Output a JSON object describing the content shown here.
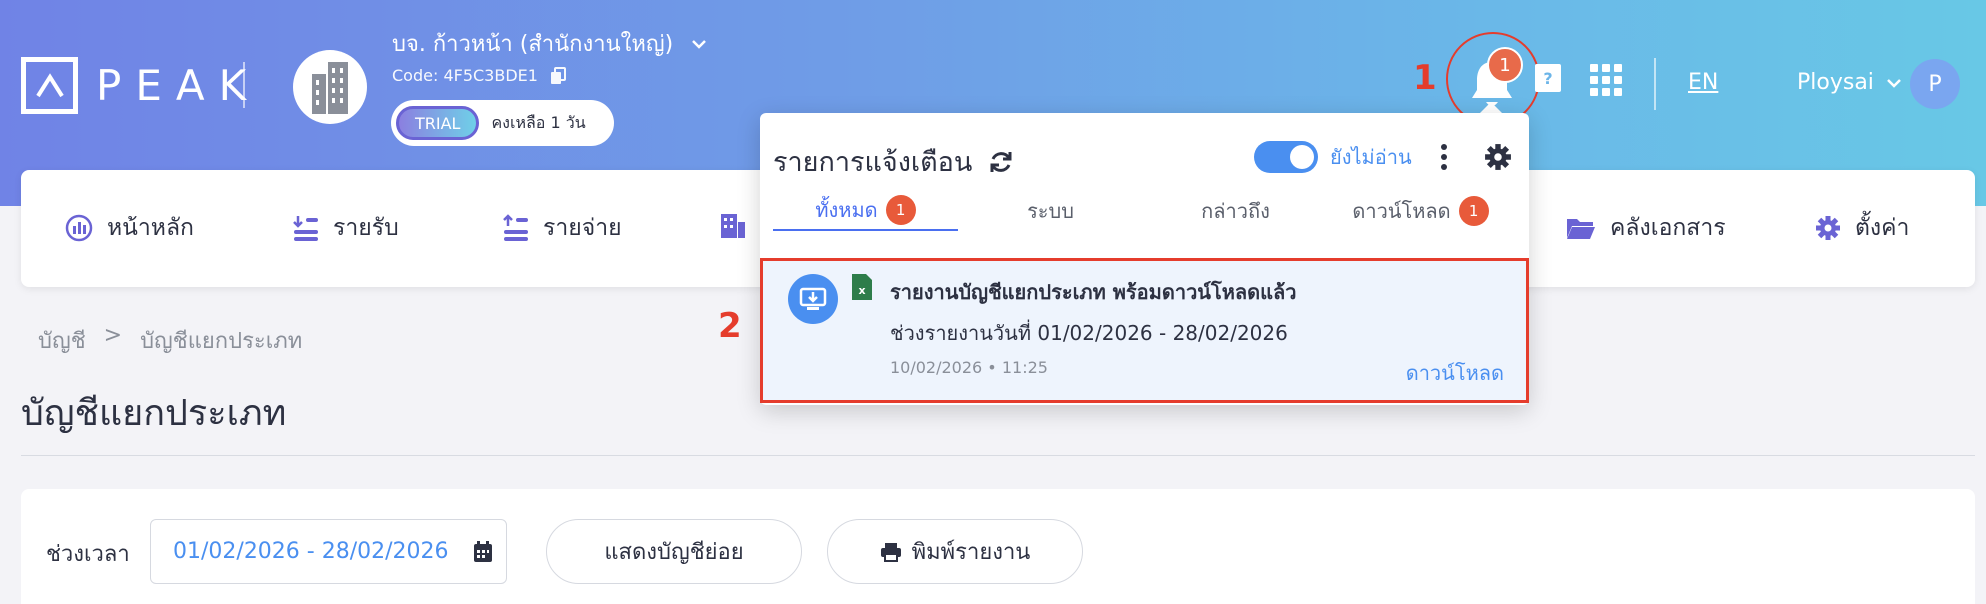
{
  "app": {
    "logo_text": "PEAK"
  },
  "company": {
    "name": "บจ. ก้าวหน้า (สำนักงานใหญ่)",
    "code": "Code: 4F5C3BDE1",
    "trial_badge": "TRIAL",
    "trial_remaining": "คงเหลือ 1 วัน"
  },
  "header": {
    "notification_count": "1",
    "language": "EN",
    "user_name": "Ploysai",
    "user_initial": "P"
  },
  "annotations": {
    "step1": "1",
    "step2": "2",
    "highlight_color": "#e53c2c"
  },
  "nav": {
    "items": [
      {
        "label": "หน้าหลัก",
        "icon": "dashboard-icon"
      },
      {
        "label": "รายรับ",
        "icon": "income-icon"
      },
      {
        "label": "รายจ่าย",
        "icon": "expense-icon"
      },
      {
        "label": "คลังเอกสาร",
        "icon": "folder-icon"
      },
      {
        "label": "ตั้งค่า",
        "icon": "gear-icon"
      }
    ]
  },
  "breadcrumb": {
    "root": "บัญชี",
    "separator": ">",
    "current": "บัญชีแยกประเภท"
  },
  "page": {
    "title": "บัญชีแยกประเภท"
  },
  "filter": {
    "period_label": "ช่วงเวลา",
    "date_range": "01/02/2026 - 28/02/2026",
    "show_sub_accounts": "แสดงบัญชีย่อย",
    "print_report": "พิมพ์รายงาน"
  },
  "notifications": {
    "title": "รายการแจ้งเตือน",
    "unread_toggle_label": "ยังไม่อ่าน",
    "tabs": [
      {
        "label": "ทั้งหมด",
        "badge": "1"
      },
      {
        "label": "ระบบ",
        "badge": ""
      },
      {
        "label": "กล่าวถึง",
        "badge": ""
      },
      {
        "label": "ดาวน์โหลด",
        "badge": "1"
      }
    ],
    "item": {
      "title": "รายงานบัญชีแยกประเภท พร้อมดาวน์โหลดแล้ว",
      "description": "ช่วงรายงานวันที่ 01/02/2026 - 28/02/2026",
      "time": "10/02/2026 • 11:25",
      "action": "ดาวน์โหลด"
    }
  },
  "colors": {
    "accent": "#4a8ff0",
    "badge": "#e85a3a",
    "gradient_start": "#7083e6",
    "gradient_end": "#68c8e6"
  }
}
